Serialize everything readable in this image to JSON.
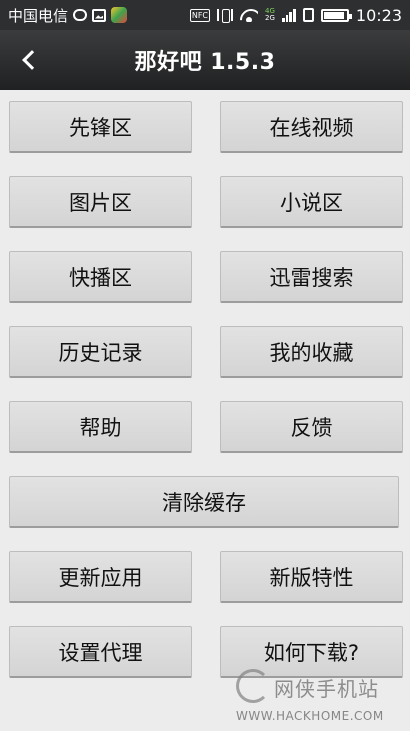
{
  "status_bar": {
    "carrier": "中国电信",
    "network_top": "4G",
    "network_bottom": "2G",
    "nfc": "NFC",
    "time": "10:23",
    "battery_level": 0.9,
    "icons": [
      "message-icon",
      "image-icon",
      "app-icon",
      "nfc-icon",
      "vibrate-icon",
      "wifi-icon",
      "signal-icon",
      "sim-icon",
      "battery-icon"
    ]
  },
  "header": {
    "title": "那好吧 1.5.3",
    "back_icon": "chevron-left-icon"
  },
  "menu": {
    "rows": [
      [
        "先锋区",
        "在线视频"
      ],
      [
        "图片区",
        "小说区"
      ],
      [
        "快播区",
        "迅雷搜索"
      ],
      [
        "历史记录",
        "我的收藏"
      ],
      [
        "帮助",
        "反馈"
      ],
      [
        "清除缓存"
      ],
      [
        "更新应用",
        "新版特性"
      ],
      [
        "设置代理",
        "如何下载?"
      ]
    ]
  },
  "watermark": {
    "name": "网侠手机站",
    "url": "WWW.HACKHOME.COM"
  },
  "colors": {
    "status_bar_bg": "#2d2f30",
    "title_bar_bg": "#2a2b2c",
    "page_bg": "#ececec",
    "button_bg": "#dcdcdc"
  }
}
